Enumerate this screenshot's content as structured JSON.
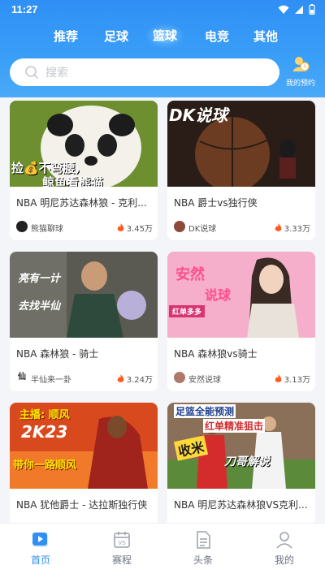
{
  "status_bar": {
    "time": "11:27"
  },
  "tabs": [
    {
      "label": "推荐"
    },
    {
      "label": "足球"
    },
    {
      "label": "篮球",
      "active": true
    },
    {
      "label": "电竞"
    },
    {
      "label": "其他"
    }
  ],
  "search": {
    "placeholder": "搜索"
  },
  "reservation": {
    "label": "我的预约"
  },
  "cards": [
    {
      "title": "NBA 明尼苏达森林狼 - 克利...",
      "author": "熊猫聊球",
      "heat": "3.45万",
      "overlay": [
        "捡💰不弯腰,",
        "鲸鱼看熊猫"
      ]
    },
    {
      "title": "NBA 爵士vs独行侠",
      "author": "DK说球",
      "heat": "3.33万",
      "overlay": [
        "DK说球"
      ]
    },
    {
      "title": "NBA 森林狼 - 骑士",
      "author": "半仙来一卦",
      "heat": "3.24万",
      "overlay": [
        "亮有一计",
        "去找半仙"
      ]
    },
    {
      "title": "NBA 森林狼vs骑士",
      "author": "安然说球",
      "heat": "3.13万",
      "overlay": [
        "安然",
        "说球",
        "红单多多"
      ]
    },
    {
      "title": "NBA 犹他爵士 - 达拉斯独行侠",
      "author": "",
      "heat": "",
      "overlay": [
        "主播: 顺风",
        "2K23",
        "带你一路顺风"
      ]
    },
    {
      "title": "NBA 明尼苏达森林狼VS克利...",
      "author": "",
      "heat": "",
      "overlay": [
        "足篮全能预测",
        "红单精准狙击",
        "收米",
        "刀哥解说"
      ]
    }
  ],
  "tabbar": [
    {
      "label": "首页",
      "icon": "home-icon",
      "active": true
    },
    {
      "label": "赛程",
      "icon": "schedule-icon"
    },
    {
      "label": "头条",
      "icon": "news-icon"
    },
    {
      "label": "我的",
      "icon": "profile-icon"
    }
  ],
  "colors": {
    "brand": "#2f8ff5",
    "heat": "#ff5a1f"
  }
}
